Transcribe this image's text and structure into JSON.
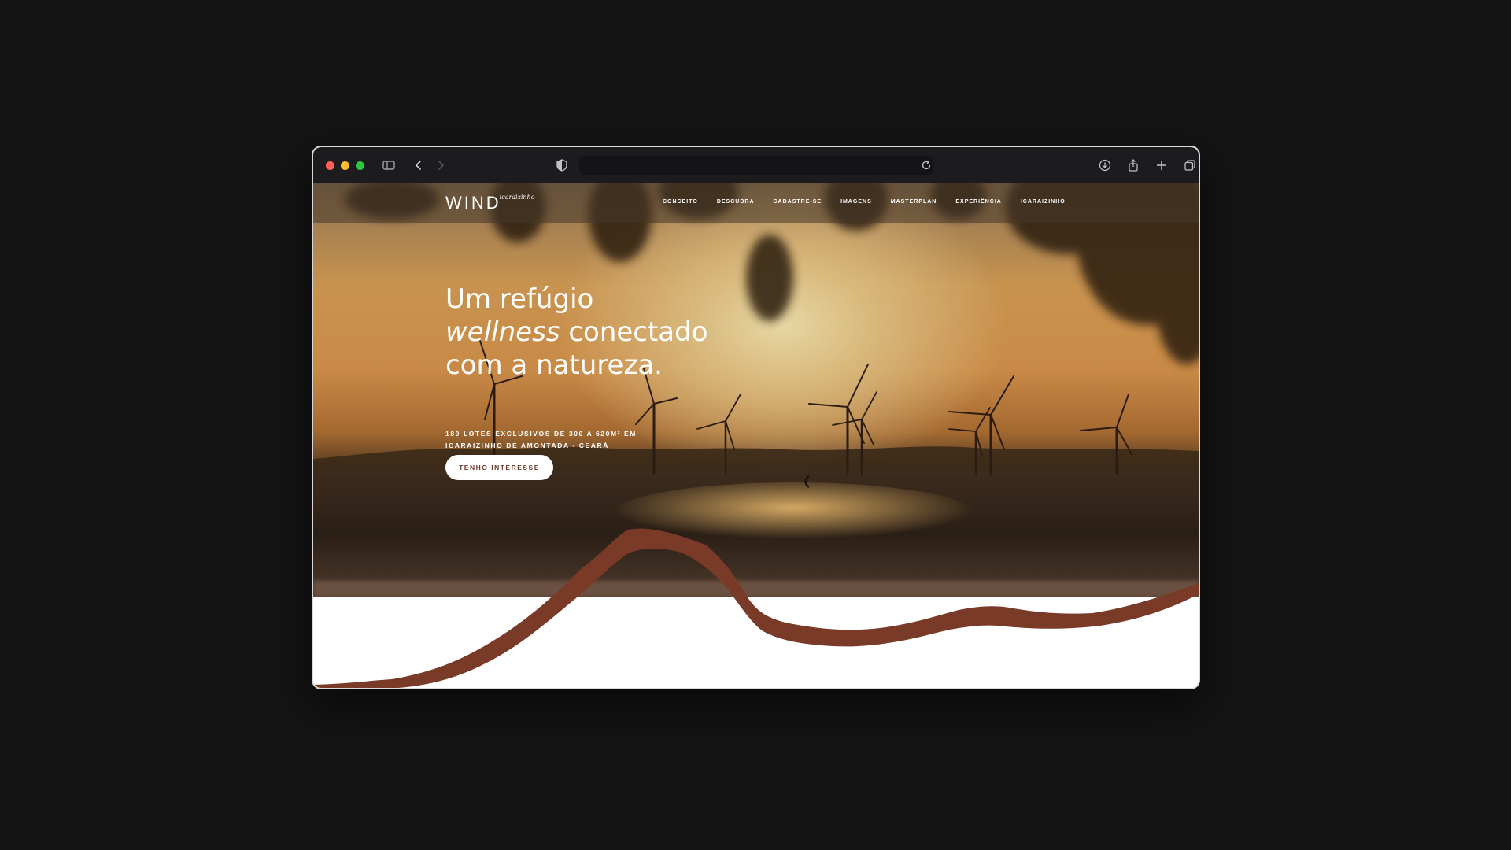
{
  "browser": {
    "icons": [
      "close-dot",
      "minimize-dot",
      "maximize-dot",
      "sidebar-icon",
      "back-icon",
      "forward-icon",
      "shield-icon",
      "reload-icon",
      "download-icon",
      "share-icon",
      "plus-icon",
      "tabs-icon"
    ],
    "colors": {
      "close": "#ff5f57",
      "minimize": "#febc2e",
      "maximize": "#28c840"
    }
  },
  "site": {
    "logo_word": "WIND",
    "logo_script": "icaraizinho",
    "nav": [
      "CONCEITO",
      "DESCUBRA",
      "CADASTRE-SE",
      "IMAGENS",
      "MASTERPLAN",
      "EXPERIÊNCIA",
      "ICARAIZINHO"
    ],
    "headline": {
      "line1": "Um refúgio",
      "line2_italic": "wellness",
      "line2_rest": " conectado",
      "line3": "com a natureza."
    },
    "sub_line1": "180 LOTES EXCLUSIVOS DE 300 A 620M² EM",
    "sub_line2": "ICARAIZINHO DE AMONTADA - CEARÁ",
    "cta_label": "TENHO INTERESSE",
    "accent_color": "#7a3a28"
  }
}
